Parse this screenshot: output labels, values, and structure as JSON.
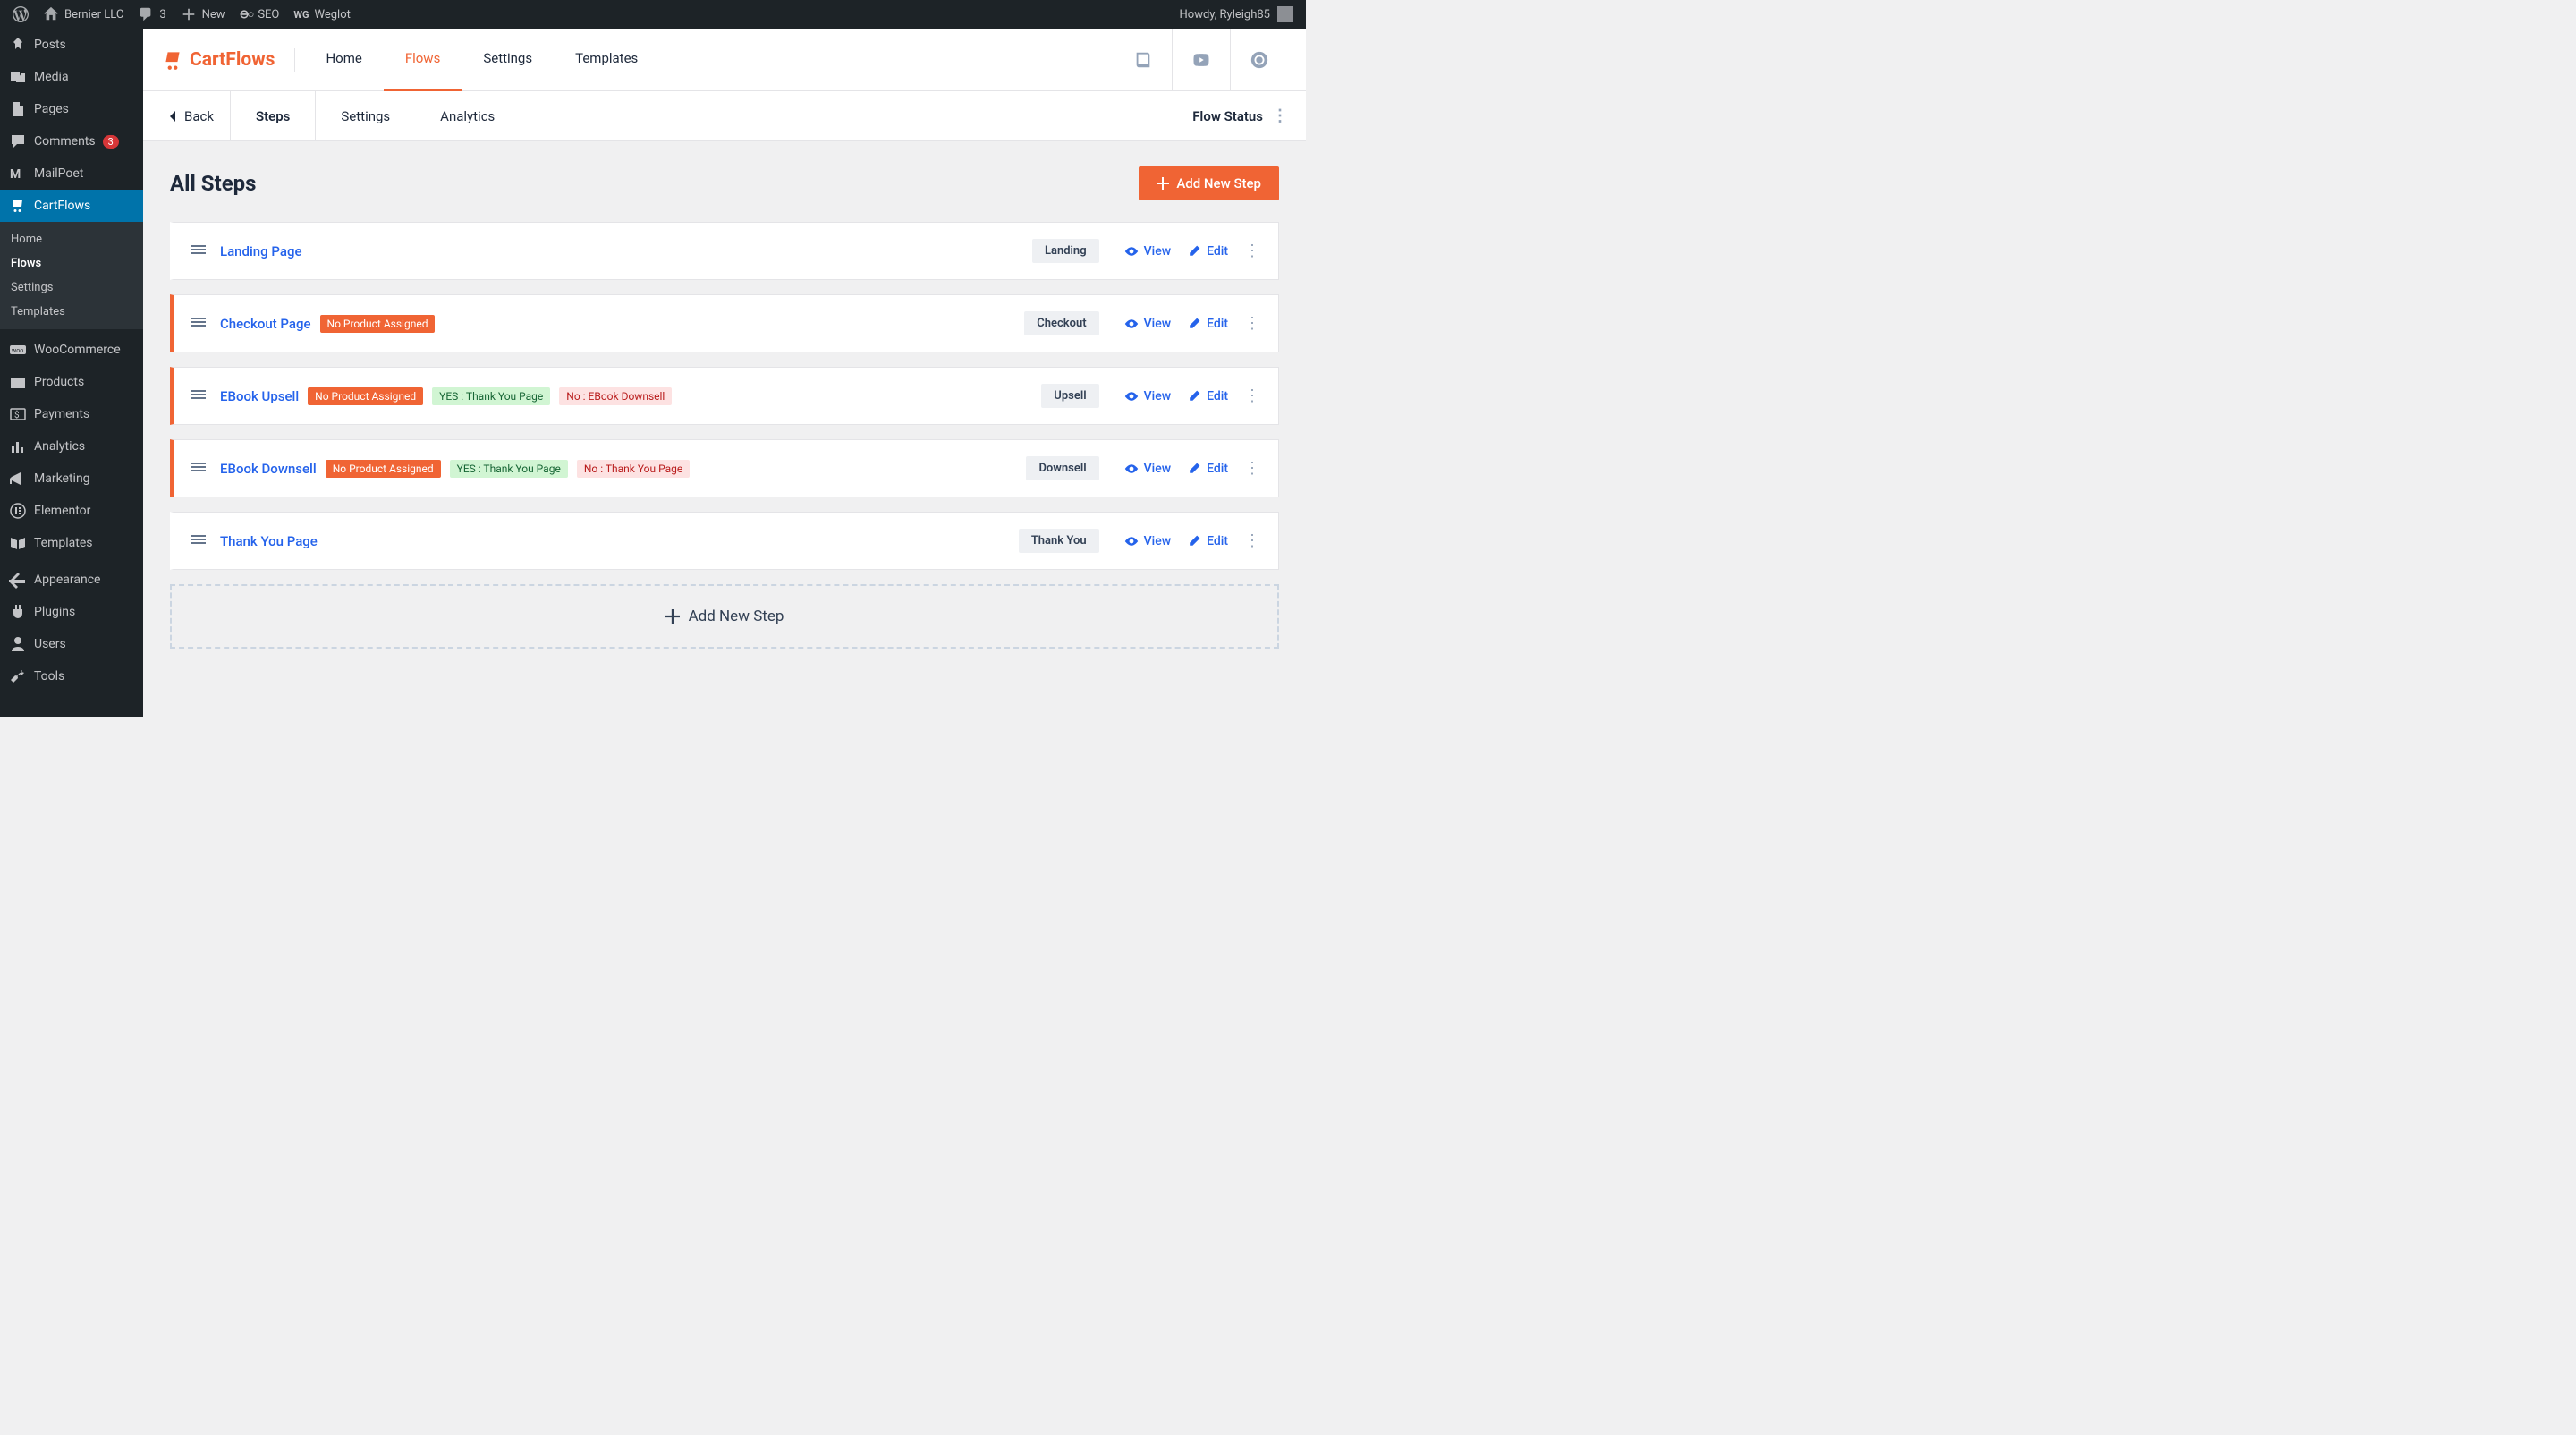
{
  "admin_bar": {
    "site_name": "Bernier LLC",
    "comments_count": "3",
    "new_label": "New",
    "seo_label": "SEO",
    "weglot_label": "Weglot",
    "howdy": "Howdy, Ryleigh85"
  },
  "sidebar": {
    "items": [
      {
        "label": "Posts",
        "icon": "pin"
      },
      {
        "label": "Media",
        "icon": "media"
      },
      {
        "label": "Pages",
        "icon": "page"
      },
      {
        "label": "Comments",
        "icon": "comment",
        "badge": "3"
      },
      {
        "label": "MailPoet",
        "icon": "mailpoet"
      },
      {
        "label": "CartFlows",
        "icon": "cartflows",
        "active": true
      },
      {
        "label": "WooCommerce",
        "icon": "woo"
      },
      {
        "label": "Products",
        "icon": "products"
      },
      {
        "label": "Payments",
        "icon": "payments"
      },
      {
        "label": "Analytics",
        "icon": "analytics"
      },
      {
        "label": "Marketing",
        "icon": "marketing"
      },
      {
        "label": "Elementor",
        "icon": "elementor"
      },
      {
        "label": "Templates",
        "icon": "templates"
      },
      {
        "label": "Appearance",
        "icon": "appearance"
      },
      {
        "label": "Plugins",
        "icon": "plugins"
      },
      {
        "label": "Users",
        "icon": "users"
      },
      {
        "label": "Tools",
        "icon": "tools"
      }
    ],
    "submenu": [
      {
        "label": "Home"
      },
      {
        "label": "Flows",
        "current": true
      },
      {
        "label": "Settings"
      },
      {
        "label": "Templates"
      }
    ]
  },
  "cf_header": {
    "brand": "CartFlows",
    "nav": [
      {
        "label": "Home"
      },
      {
        "label": "Flows",
        "active": true
      },
      {
        "label": "Settings"
      },
      {
        "label": "Templates"
      }
    ]
  },
  "flow_subheader": {
    "back": "Back",
    "tabs": [
      {
        "label": "Steps",
        "active": true
      },
      {
        "label": "Settings"
      },
      {
        "label": "Analytics"
      }
    ],
    "status_label": "Flow Status"
  },
  "content": {
    "title": "All Steps",
    "add_new_btn": "Add New Step",
    "add_new_placeholder": "Add New Step",
    "view_label": "View",
    "edit_label": "Edit",
    "steps": [
      {
        "title": "Landing Page",
        "type": "Landing",
        "warn": false,
        "tags": []
      },
      {
        "title": "Checkout Page",
        "type": "Checkout",
        "warn": true,
        "tags": [
          {
            "text": "No Product Assigned",
            "style": "orange"
          }
        ]
      },
      {
        "title": "EBook Upsell",
        "type": "Upsell",
        "warn": true,
        "tags": [
          {
            "text": "No Product Assigned",
            "style": "orange"
          },
          {
            "text": "YES : Thank You Page",
            "style": "green"
          },
          {
            "text": "No : EBook Downsell",
            "style": "red"
          }
        ]
      },
      {
        "title": "EBook Downsell",
        "type": "Downsell",
        "warn": true,
        "tags": [
          {
            "text": "No Product Assigned",
            "style": "orange"
          },
          {
            "text": "YES : Thank You Page",
            "style": "green"
          },
          {
            "text": "No : Thank You Page",
            "style": "red"
          }
        ]
      },
      {
        "title": "Thank You Page",
        "type": "Thank You",
        "warn": false,
        "tags": []
      }
    ]
  }
}
